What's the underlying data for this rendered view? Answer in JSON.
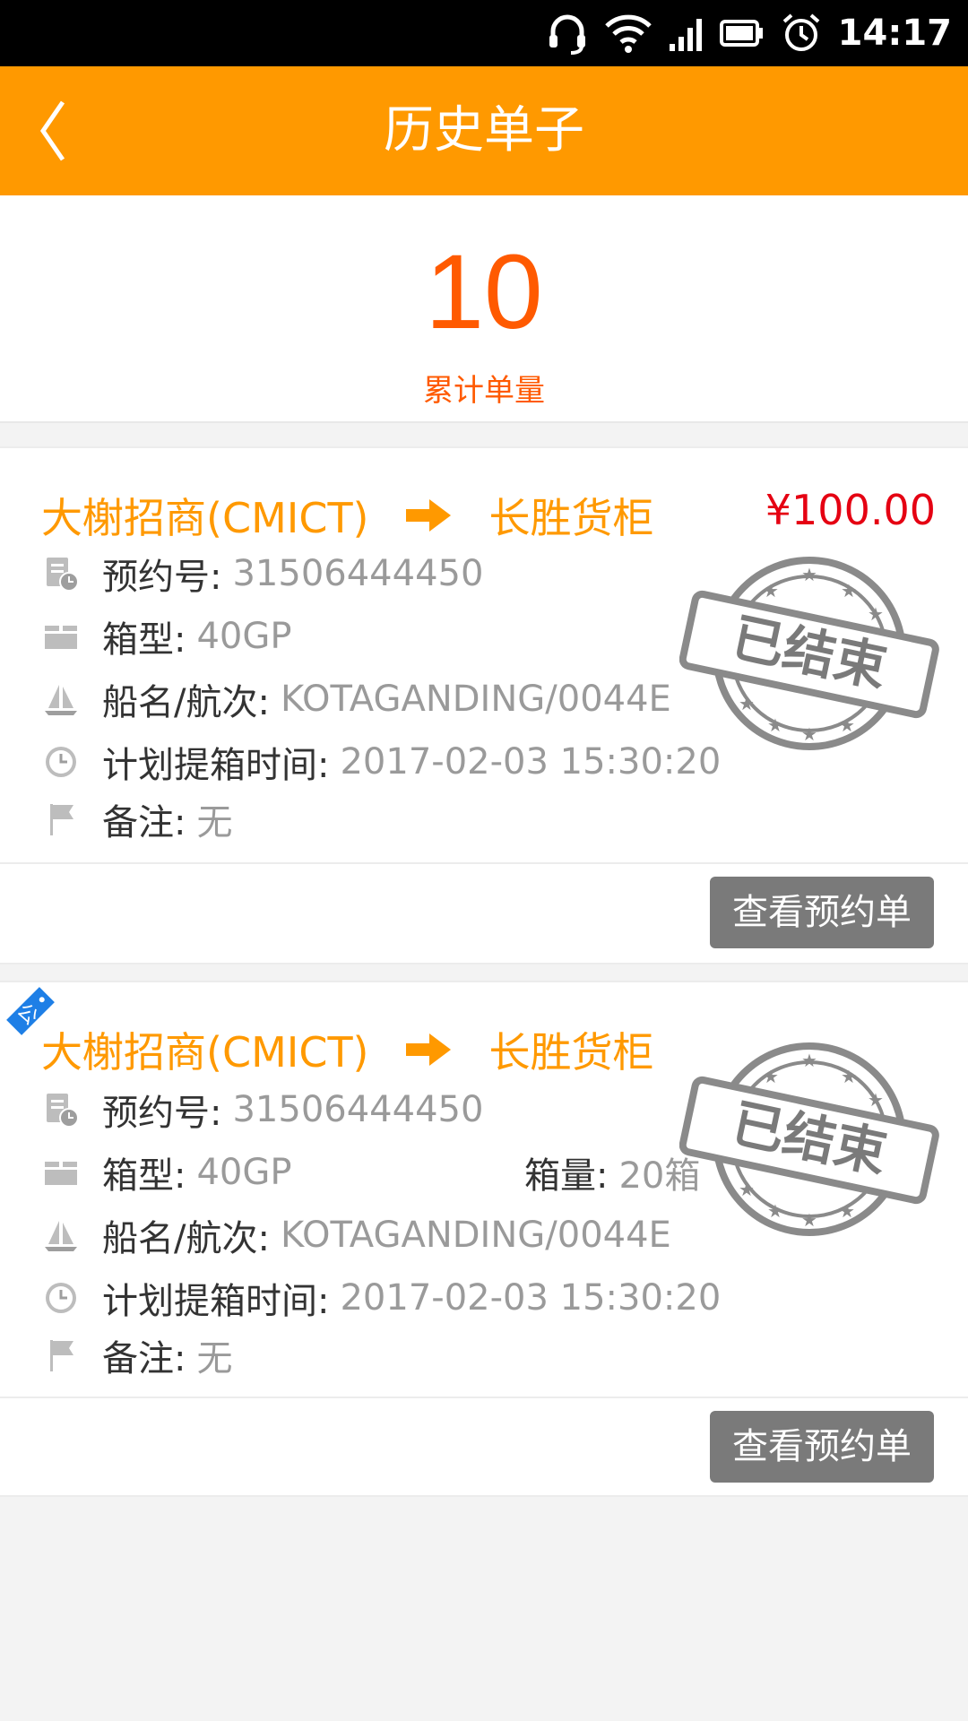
{
  "status_bar": {
    "time": "14:17"
  },
  "header": {
    "title": "历史单子"
  },
  "summary": {
    "count": "10",
    "caption": "累计单量"
  },
  "orders": [
    {
      "from": "大榭招商(CMICT)",
      "to": "长胜货柜",
      "price": "¥100.00",
      "booking_label": "预约号:",
      "booking_no": "31506444450",
      "container_label": "箱型:",
      "container_type": "40GP",
      "vessel_label": "船名/航次:",
      "vessel": "KOTAGANDING/0044E",
      "time_label": "计划提箱时间:",
      "time": "2017-02-03  15:30:20",
      "remark_label": "备注:",
      "remark": "无",
      "stamp_text": "已结束",
      "button": "查看预约单"
    },
    {
      "from": "大榭招商(CMICT)",
      "to": "长胜货柜",
      "tag_text": "公",
      "booking_label": "预约号:",
      "booking_no": "31506444450",
      "container_label": "箱型:",
      "container_type": "40GP",
      "qty_label": "箱量:",
      "qty": "20箱",
      "vessel_label": "船名/航次:",
      "vessel": "KOTAGANDING/0044E",
      "time_label": "计划提箱时间:",
      "time": "2017-02-03  15:30:20",
      "remark_label": "备注:",
      "remark": "无",
      "stamp_text": "已结束",
      "button": "查看预约单"
    }
  ],
  "colors": {
    "header": "#ff9900",
    "accent": "#ff5a00",
    "price": "#e50012",
    "button": "#7a7a7a"
  }
}
